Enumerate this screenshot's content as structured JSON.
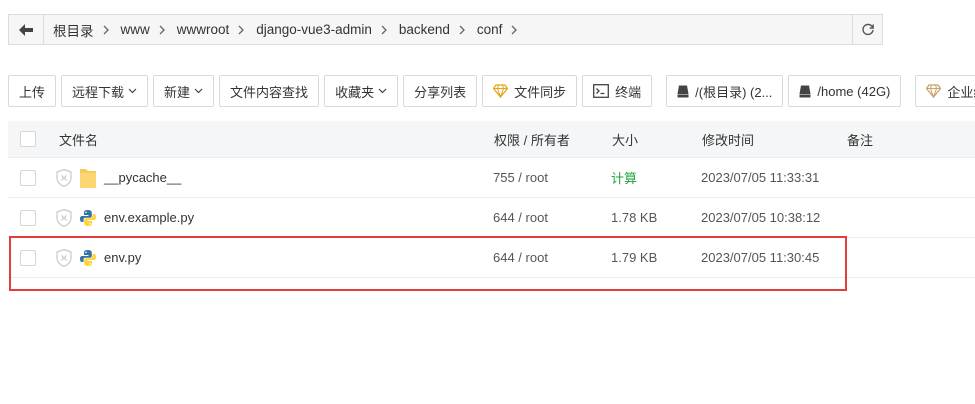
{
  "breadcrumb": {
    "items": [
      "根目录",
      "www",
      "wwwroot",
      "django-vue3-admin",
      "backend",
      "conf"
    ]
  },
  "toolbar": {
    "upload": "上传",
    "remote_download": "远程下载",
    "new": "新建",
    "content_search": "文件内容查找",
    "favorites": "收藏夹",
    "share_list": "分享列表",
    "file_sync": "文件同步",
    "terminal": "终端",
    "disk_root": "/(根目录) (2...",
    "disk_home": "/home (42G)",
    "enterprise": "企业级防"
  },
  "table": {
    "headers": {
      "name": "文件名",
      "perm": "权限 / 所有者",
      "size": "大小",
      "mtime": "修改时间",
      "note": "备注"
    },
    "rows": [
      {
        "name": "__pycache__",
        "type": "folder",
        "perm": "755 / root",
        "size": "计算",
        "mtime": "2023/07/05 11:33:31"
      },
      {
        "name": "env.example.py",
        "type": "python",
        "perm": "644 / root",
        "size": "1.78 KB",
        "mtime": "2023/07/05 10:38:12"
      },
      {
        "name": "env.py",
        "type": "python",
        "perm": "644 / root",
        "size": "1.79 KB",
        "mtime": "2023/07/05 11:30:45"
      }
    ]
  },
  "colors": {
    "accent_green": "#20a53a",
    "highlight_red": "#e33e3e",
    "folder_yellow": "#f7c95c",
    "python_blue": "#3572a5",
    "python_yellow": "#ffd43b"
  }
}
